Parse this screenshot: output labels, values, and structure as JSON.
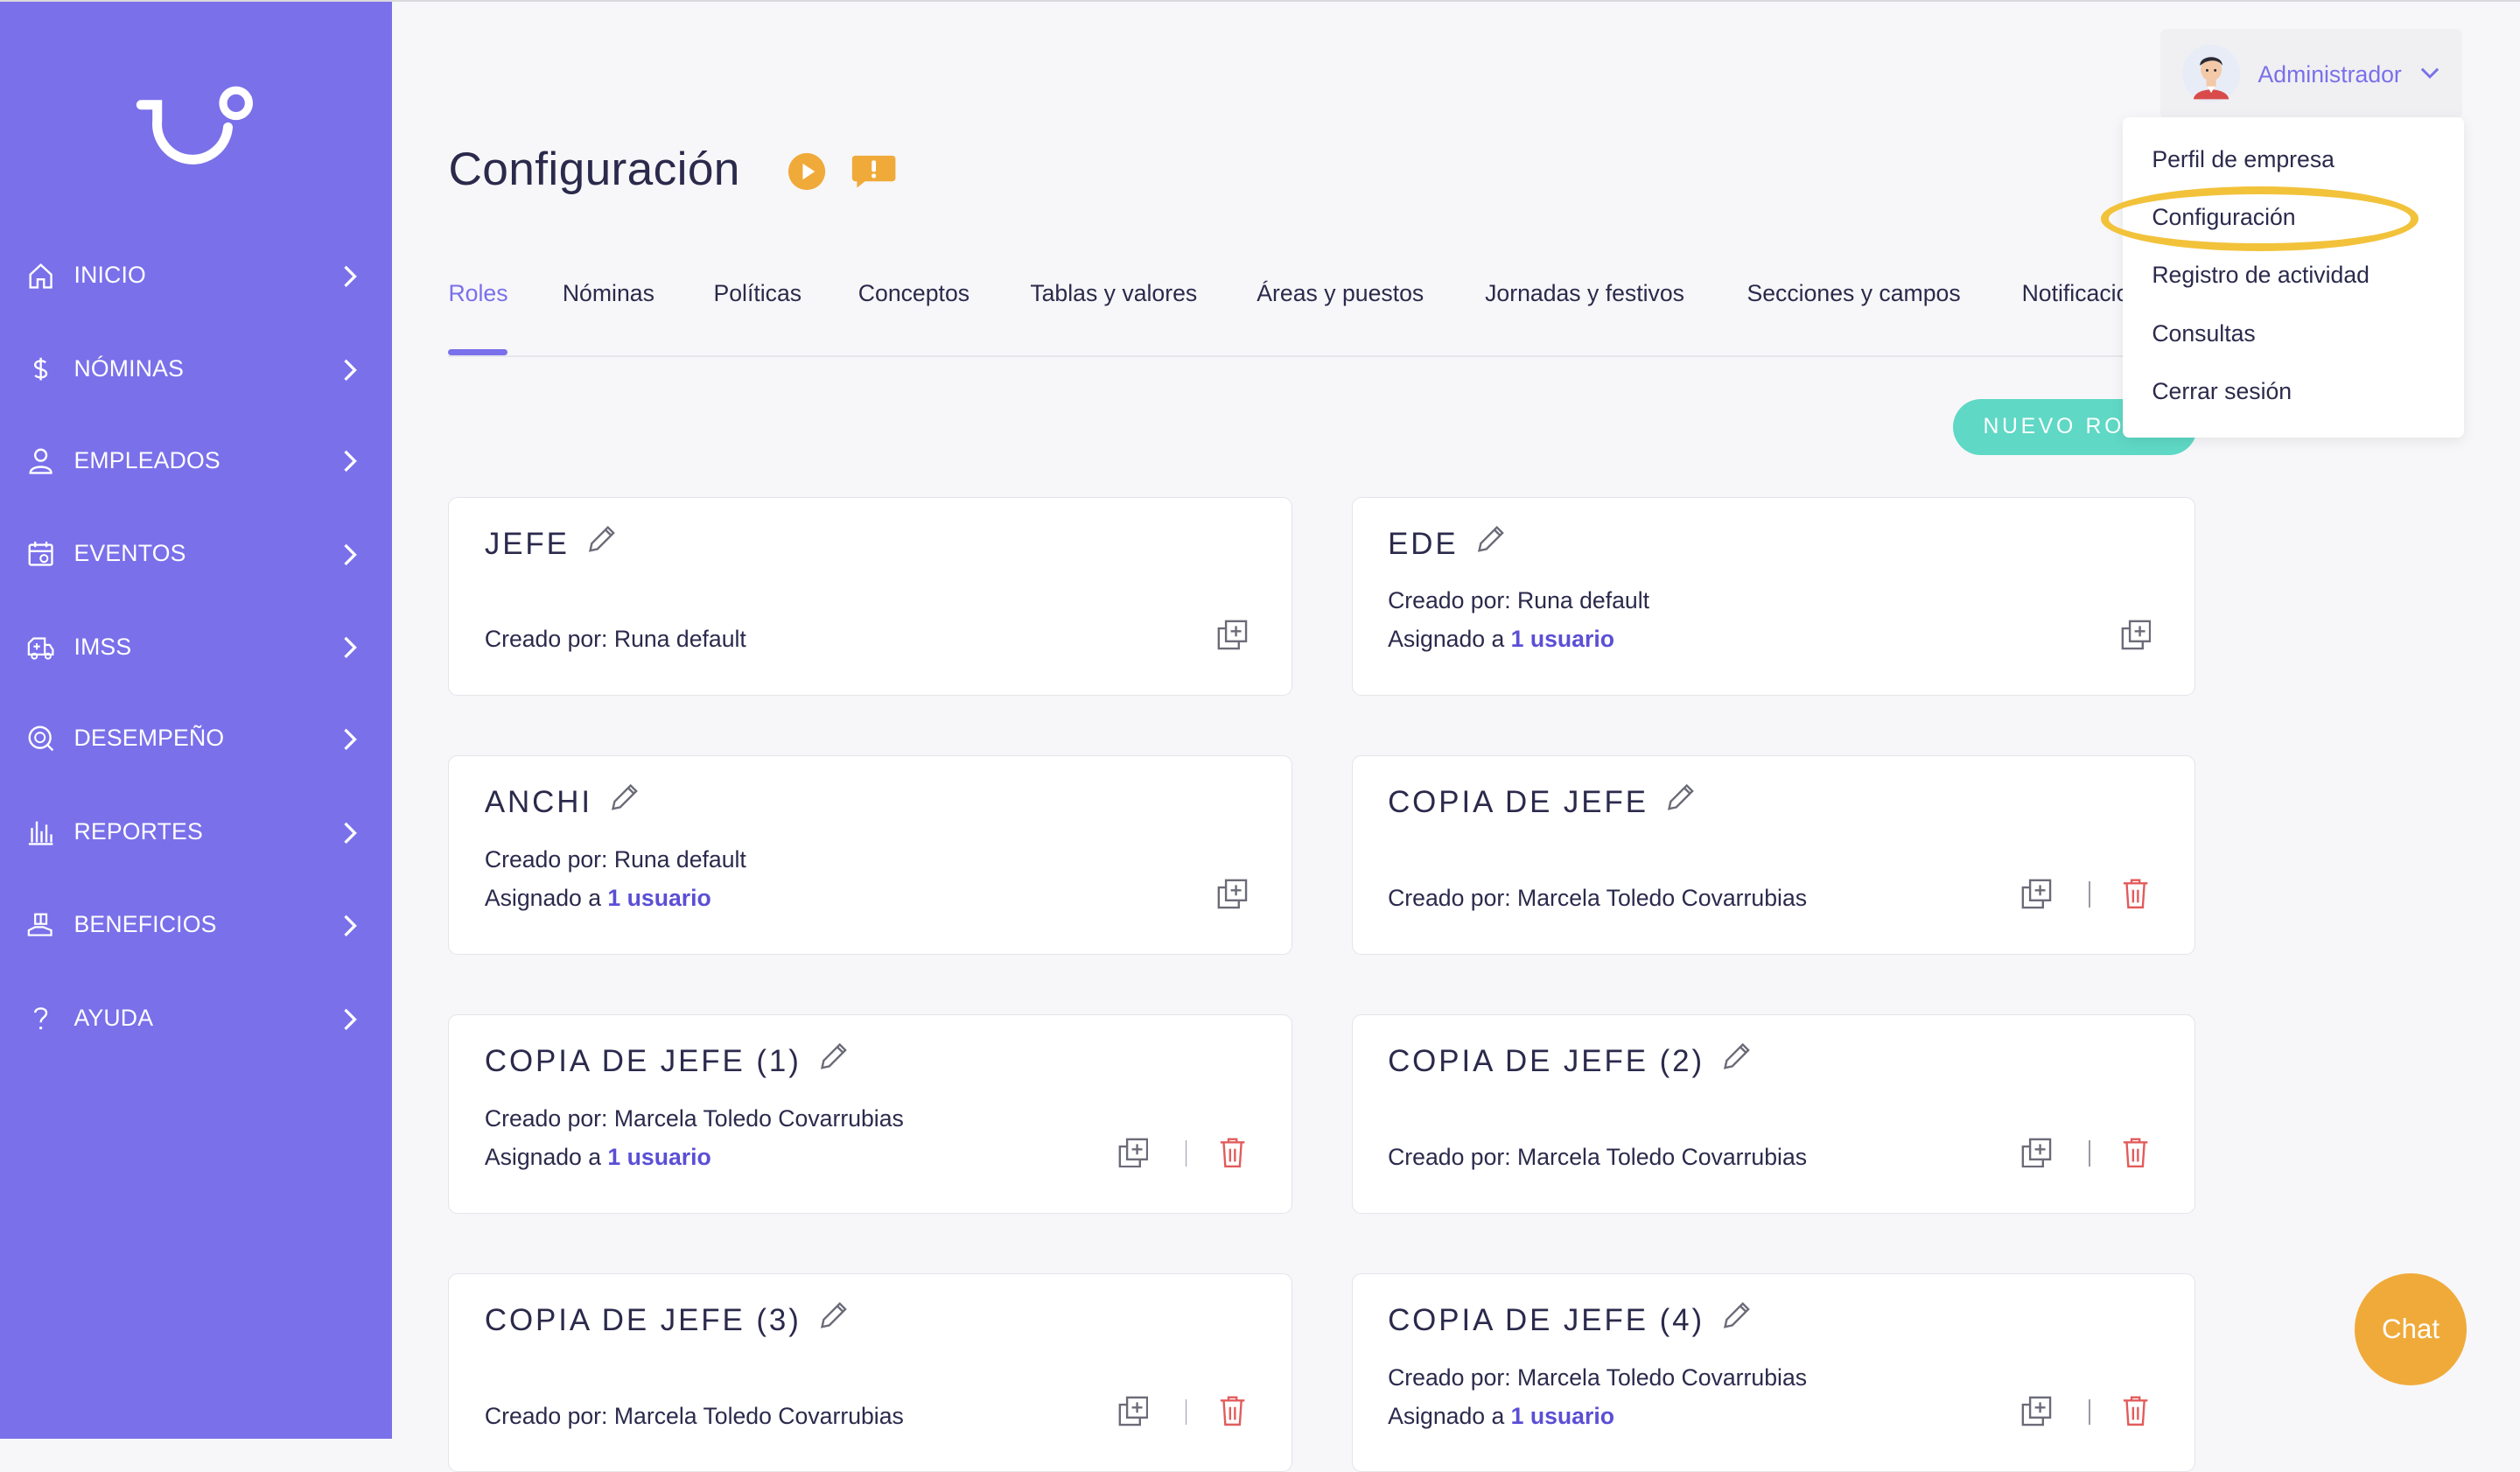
{
  "sidebar": {
    "logo": "runa-logo-icon",
    "items": [
      {
        "label": "INICIO",
        "icon": "home-icon"
      },
      {
        "label": "NÓMINAS",
        "icon": "dollar-icon"
      },
      {
        "label": "EMPLEADOS",
        "icon": "user-icon"
      },
      {
        "label": "EVENTOS",
        "icon": "calendar-icon"
      },
      {
        "label": "IMSS",
        "icon": "ambulance-icon"
      },
      {
        "label": "DESEMPEÑO",
        "icon": "performance-icon"
      },
      {
        "label": "REPORTES",
        "icon": "bar-chart-icon"
      },
      {
        "label": "BENEFICIOS",
        "icon": "gift-hand-icon"
      },
      {
        "label": "AYUDA",
        "icon": "question-icon"
      }
    ]
  },
  "header": {
    "title": "Configuración"
  },
  "tabs": [
    {
      "label": "Roles"
    },
    {
      "label": "Nóminas"
    },
    {
      "label": "Políticas"
    },
    {
      "label": "Conceptos"
    },
    {
      "label": "Tablas y valores"
    },
    {
      "label": "Áreas y puestos"
    },
    {
      "label": "Jornadas y festivos"
    },
    {
      "label": "Secciones y campos"
    },
    {
      "label": "Notificaciones"
    }
  ],
  "new_role_button": "NUEVO ROL",
  "roles": [
    {
      "title": "JEFE",
      "line1": "",
      "created": "Creado por: Runa default",
      "assigned_prefix": "",
      "assigned_link": ""
    },
    {
      "title": "EDE",
      "created": "Creado por: Runa default",
      "assigned_prefix": "Asignado a",
      "assigned_link": "1 usuario"
    },
    {
      "title": "ANCHI",
      "created": "Creado por: Runa default",
      "assigned_prefix": "Asignado a",
      "assigned_link": "1 usuario"
    },
    {
      "title": "COPIA DE JEFE",
      "created": "Creado por: Marcela Toledo Covarrubias",
      "assigned_prefix": "",
      "assigned_link": ""
    },
    {
      "title": "COPIA DE JEFE (1)",
      "created": "Creado por: Marcela Toledo Covarrubias",
      "assigned_prefix": "Asignado a",
      "assigned_link": "1 usuario"
    },
    {
      "title": "COPIA DE JEFE (2)",
      "created": "Creado por: Marcela Toledo Covarrubias",
      "assigned_prefix": "",
      "assigned_link": ""
    },
    {
      "title": "COPIA DE JEFE (3)",
      "created": "Creado por: Marcela Toledo Covarrubias",
      "assigned_prefix": "",
      "assigned_link": ""
    },
    {
      "title": "COPIA DE JEFE (4)",
      "created": "Creado por: Marcela Toledo Covarrubias",
      "assigned_prefix": "Asignado a",
      "assigned_link": "1 usuario"
    }
  ],
  "user_menu": {
    "name": "Administrador",
    "items": [
      {
        "label": "Perfil de empresa"
      },
      {
        "label": "Configuración"
      },
      {
        "label": "Registro de actividad"
      },
      {
        "label": "Consultas"
      },
      {
        "label": "Cerrar sesión"
      }
    ]
  },
  "chat_button": "Chat",
  "colors": {
    "sidebar": "#7a70ea",
    "accent": "#7a70ea",
    "new_role": "#5fd8c5",
    "chat": "#f0aa3a",
    "highlight": "#f2c23a",
    "trash": "#e25b5b"
  }
}
